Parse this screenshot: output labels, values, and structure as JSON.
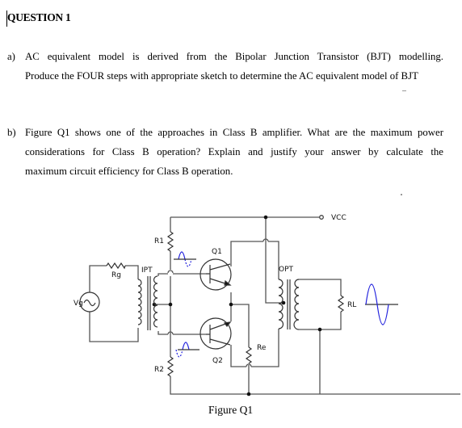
{
  "question": {
    "title": "QUESTION 1"
  },
  "part_a": {
    "label": "a)",
    "lines": [
      "AC equivalent model is derived from the Bipolar Junction Transistor (BJT) modelling.",
      "Produce the FOUR steps with appropriate sketch to determine the AC equivalent model of BJT"
    ]
  },
  "part_b": {
    "label": "b)",
    "lines": [
      "Figure Q1 shows one of the approaches in Class B amplifier. What are the maximum power",
      "considerations for Class B operation? Explain and justify your answer by calculate the",
      "maximum circuit efficiency for Class B operation."
    ]
  },
  "figure": {
    "caption": "Figure Q1",
    "labels": {
      "vcc": "VCC",
      "r1": "R1",
      "r2": "R2",
      "rg": "Rg",
      "vg": "Vg",
      "ipt": "IPT",
      "opt": "OPT",
      "q1": "Q1",
      "q2": "Q2",
      "re": "Re",
      "rl": "RL"
    },
    "colors": {
      "wire": "#555555",
      "component": "#333333",
      "waveform": "#2222dd"
    }
  }
}
